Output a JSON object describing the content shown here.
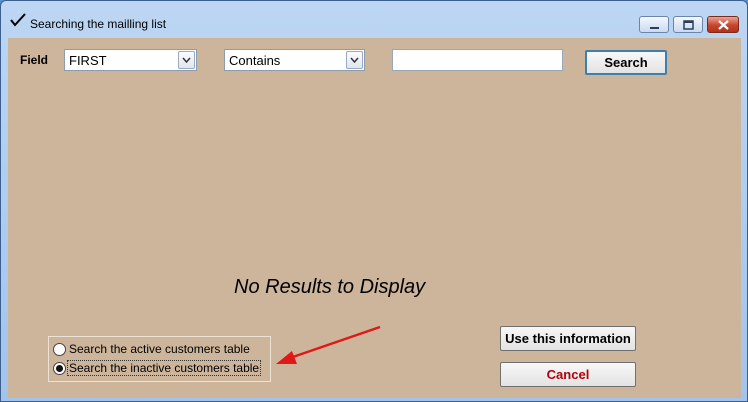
{
  "window": {
    "title": "Searching the mailling list"
  },
  "filters": {
    "field_label": "Field",
    "field_value": "FIRST",
    "operator_value": "Contains",
    "search_text": "",
    "search_button": "Search"
  },
  "results": {
    "empty_message": "No Results to Display"
  },
  "table_choice": {
    "options": [
      {
        "label": "Search the active customers table",
        "selected": false
      },
      {
        "label": "Search the inactive customers table",
        "selected": true
      }
    ]
  },
  "actions": {
    "use_button": "Use this information",
    "cancel_button": "Cancel"
  },
  "colors": {
    "client_bg": "#cdb59c",
    "cancel_text": "#b3000c",
    "annotation_arrow": "#e01818"
  },
  "icons": {
    "title": "checkmark-icon",
    "annotation": "red-arrow-icon"
  }
}
